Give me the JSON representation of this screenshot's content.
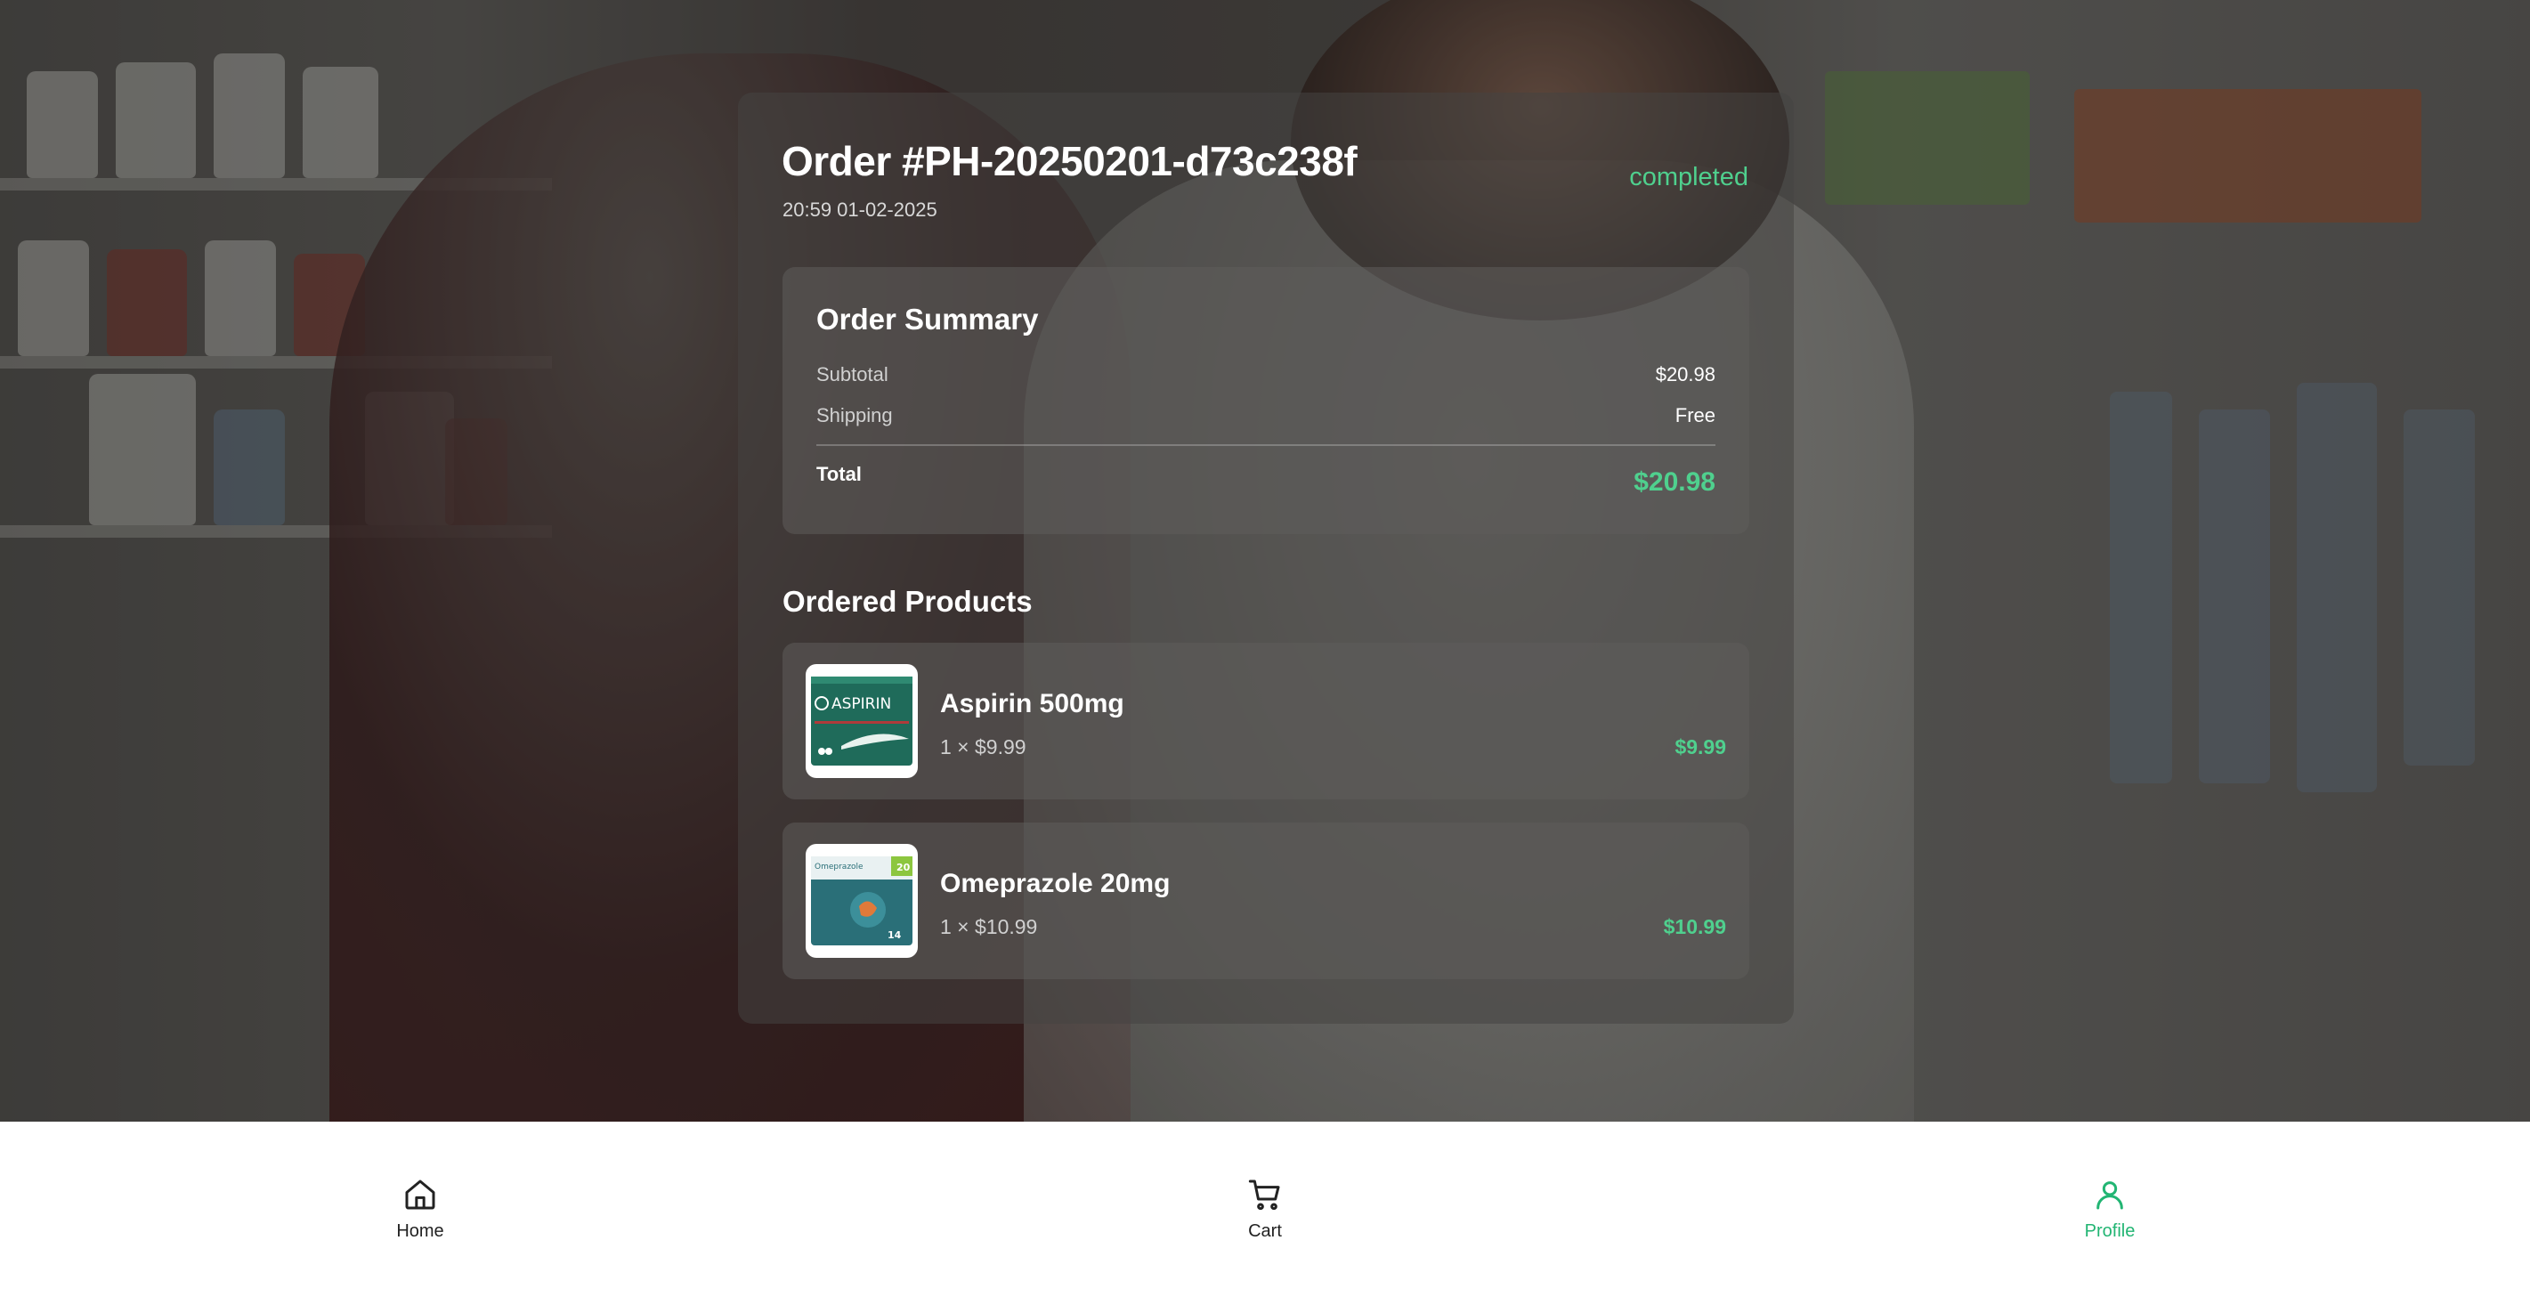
{
  "order": {
    "title": "Order #PH-20250201-d73c238f",
    "datetime": "20:59 01-02-2025",
    "status": "completed",
    "status_color": "#4fd08e"
  },
  "summary": {
    "title": "Order Summary",
    "subtotal_label": "Subtotal",
    "subtotal_value": "$20.98",
    "shipping_label": "Shipping",
    "shipping_value": "Free",
    "total_label": "Total",
    "total_value": "$20.98"
  },
  "products": {
    "title": "Ordered Products",
    "items": [
      {
        "name": "Aspirin 500mg",
        "quantity_line": "1 × $9.99",
        "price": "$9.99",
        "thumbnail_text": "ASPIRIN"
      },
      {
        "name": "Omeprazole 20mg",
        "quantity_line": "1 × $10.99",
        "price": "$10.99",
        "thumbnail_text": "Omeprazole",
        "thumbnail_badge": "20",
        "thumbnail_count": "14"
      }
    ]
  },
  "nav": {
    "items": [
      {
        "label": "Home",
        "icon": "home-icon",
        "active": false
      },
      {
        "label": "Cart",
        "icon": "cart-icon",
        "active": false
      },
      {
        "label": "Profile",
        "icon": "user-icon",
        "active": true
      }
    ],
    "active_color": "#22b573"
  }
}
